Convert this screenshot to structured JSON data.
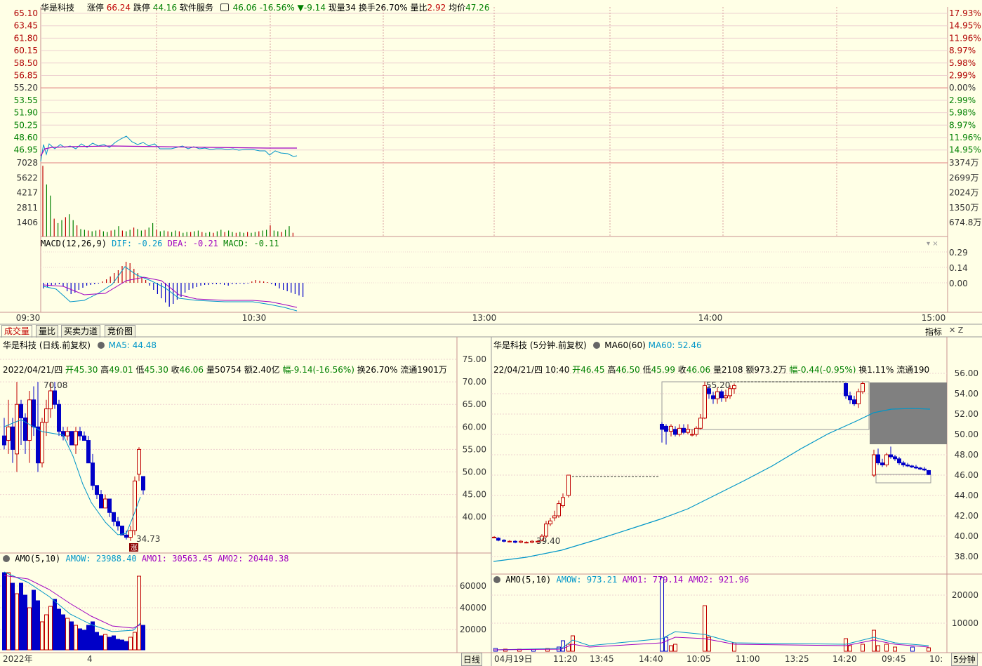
{
  "header": {
    "name": "华是科技",
    "limit_up_label": "涨停",
    "limit_up": "66.24",
    "limit_down_label": "跌停",
    "limit_down": "44.16",
    "industry": "软件服务",
    "price_change": "46.06 -16.56%",
    "change_amount": "▼-9.14",
    "current_vol_label": "现量",
    "current_vol": "34",
    "turnover_label": "换手",
    "turnover": "26.70%",
    "vol_ratio_label": "量比",
    "vol_ratio": "2.92",
    "avg_price_label": "均价",
    "avg_price": "47.26"
  },
  "intraday": {
    "price_ticks": [
      "65.10",
      "63.45",
      "61.80",
      "60.15",
      "58.50",
      "56.85",
      "55.20",
      "53.55",
      "51.90",
      "50.25",
      "48.60",
      "46.95"
    ],
    "pct_ticks": [
      "17.93%",
      "14.95%",
      "11.96%",
      "8.97%",
      "5.98%",
      "2.99%",
      "0.00%",
      "2.99%",
      "5.98%",
      "8.97%",
      "11.96%",
      "14.95%"
    ],
    "vol_ticks_left": [
      "7028",
      "5622",
      "4217",
      "2811",
      "1406"
    ],
    "vol_ticks_right": [
      "3374万",
      "2699万",
      "2024万",
      "1350万",
      "674.8万"
    ],
    "time_ticks": [
      "09:30",
      "10:30",
      "13:00",
      "14:00",
      "15:00"
    ],
    "macd_label": "MACD(12,26,9)",
    "dif": "DIF: -0.26",
    "dea": "DEA: -0.21",
    "macd": "MACD: -0.11",
    "macd_ticks": [
      "0.29",
      "0.14",
      "0.00"
    ]
  },
  "tabs": [
    "成交量",
    "量比",
    "买卖力道",
    "竞价图"
  ],
  "indicator_label": "指标",
  "daily": {
    "title": "华是科技 (日线.前复权)",
    "ma_label": "MA5: 44.48",
    "info_date": "2022/04/21/四",
    "info_open_label": "开",
    "info_open": "45.30",
    "info_high_label": "高",
    "info_high": "49.01",
    "info_low_label": "低",
    "info_low": "45.30",
    "info_close_label": "收",
    "info_close": "46.06",
    "info_vol": "量50754",
    "info_amt": "额2.40亿",
    "info_range": "幅-9.14(-16.56%)",
    "info_turn": "换26.70%",
    "info_float": "流通1901万",
    "price_ticks": [
      "75.00",
      "70.00",
      "65.00",
      "60.00",
      "55.00",
      "50.00",
      "45.00",
      "40.00"
    ],
    "high_mark": "70.08",
    "low_mark": "34.73",
    "up_badge": "涨",
    "amo_label": "AMO(5,10)",
    "amow": "AMOW: 23988.40",
    "amo1": "AMO1: 30563.45",
    "amo2": "AMO2: 20440.38",
    "amo_ticks": [
      "60000",
      "40000",
      "20000"
    ],
    "x_labels": [
      "2022年",
      "4"
    ],
    "period": "日线"
  },
  "min5": {
    "title": "华是科技 (5分钟.前复权)",
    "ma_label": "MA60(60)",
    "ma_value": "MA60: 52.46",
    "info_date": "22/04/21/四 10:40",
    "info_open_label": "开",
    "info_open": "46.45",
    "info_high_label": "高",
    "info_high": "46.50",
    "info_low_label": "低",
    "info_low": "45.99",
    "info_close_label": "收",
    "info_close": "46.06",
    "info_vol": "量2108",
    "info_amt": "额973.2万",
    "info_range": "幅-0.44(-0.95%)",
    "info_turn": "换1.11%",
    "info_float": "流通190",
    "price_ticks": [
      "56.00",
      "54.00",
      "52.00",
      "50.00",
      "48.00",
      "46.00",
      "44.00",
      "42.00",
      "40.00",
      "38.00"
    ],
    "high_mark": "55.20",
    "low_mark": "39.40",
    "amo_label": "AMO(5,10)",
    "amow": "AMOW: 973.21",
    "amo1": "AMO1: 779.14",
    "amo2": "AMO2: 921.96",
    "amo_ticks": [
      "20000",
      "10000"
    ],
    "x_labels": [
      "04月19日",
      "11:20",
      "13:45",
      "14:40",
      "10:05",
      "11:00",
      "13:25",
      "14:20",
      "09:45",
      "10:"
    ],
    "period": "5分钟"
  }
}
